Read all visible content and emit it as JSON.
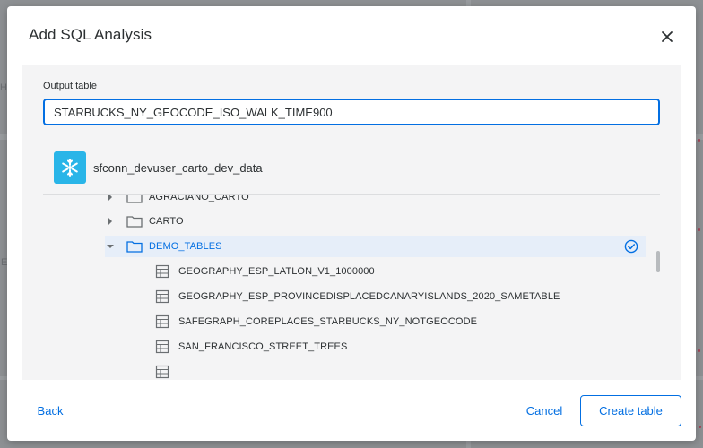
{
  "dialog": {
    "title": "Add SQL Analysis",
    "close_icon": "close-icon"
  },
  "output_table": {
    "label": "Output table",
    "value": "STARBUCKS_NY_GEOCODE_ISO_WALK_TIME900"
  },
  "connection": {
    "icon": "snowflake-icon",
    "name": "sfconn_devuser_carto_dev_data"
  },
  "tree": {
    "folders": [
      {
        "label": "AGRACIANO_CARTO",
        "expanded": false
      },
      {
        "label": "CARTO",
        "expanded": false
      },
      {
        "label": "DEMO_TABLES",
        "expanded": true,
        "selected": true
      }
    ],
    "tables": [
      {
        "label": "GEOGRAPHY_ESP_LATLON_V1_1000000"
      },
      {
        "label": "GEOGRAPHY_ESP_PROVINCEDISPLACEDCANARYISLANDS_2020_SAMETABLE"
      },
      {
        "label": "SAFEGRAPH_COREPLACES_STARBUCKS_NY_NOTGEOCODE"
      },
      {
        "label": "SAN_FRANCISCO_STREET_TREES"
      }
    ]
  },
  "footer": {
    "back_label": "Back",
    "cancel_label": "Cancel",
    "create_label": "Create table"
  },
  "colors": {
    "accent": "#036fe2",
    "selected_bg": "#e6eef9",
    "snowflake": "#29b5e8"
  },
  "backdrop": {
    "ghost_labels": [
      "Ha",
      "E"
    ]
  }
}
